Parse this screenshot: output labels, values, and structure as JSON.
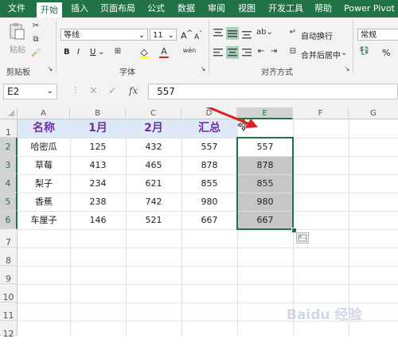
{
  "ribbon_tabs": [
    "文件",
    "开始",
    "插入",
    "页面布局",
    "公式",
    "数据",
    "审阅",
    "视图",
    "开发工具",
    "帮助",
    "Power Pivot"
  ],
  "ribbon": {
    "paste_label": "粘贴",
    "clipboard_label": "剪贴板",
    "font_name": "等线",
    "font_size": "11",
    "grow_font": "A",
    "shrink_font": "A",
    "bold": "B",
    "italic": "I",
    "underline": "U",
    "font_group_label": "字体",
    "wrap_text_label": "自动换行",
    "merge_center_label": "合并后居中",
    "alignment_group_label": "对齐方式",
    "number_format": "常规",
    "percent": "%"
  },
  "formula_bar": {
    "name_box": "E2",
    "fx_label": "fx",
    "formula": "557"
  },
  "columns": [
    "A",
    "B",
    "C",
    "D",
    "E",
    "F",
    "G"
  ],
  "rows": [
    "1",
    "2",
    "3",
    "4",
    "5",
    "6",
    "7",
    "8",
    "9",
    "10",
    "11",
    "12"
  ],
  "table": {
    "headers": [
      "名称",
      "1月",
      "2月",
      "汇总",
      ""
    ],
    "rows": [
      [
        "哈密瓜",
        "125",
        "432",
        "557",
        "557"
      ],
      [
        "草莓",
        "413",
        "465",
        "878",
        "878"
      ],
      [
        "梨子",
        "234",
        "621",
        "855",
        "855"
      ],
      [
        "香蕉",
        "238",
        "742",
        "980",
        "980"
      ],
      [
        "车厘子",
        "146",
        "521",
        "667",
        "667"
      ]
    ]
  },
  "colors": {
    "accent": "#217346",
    "header_text": "#7030a0",
    "header_fill": "#dde9f6",
    "selected_fill": "#c6c6c6",
    "arrow": "#e02020"
  },
  "watermark": "Baidu 经验"
}
